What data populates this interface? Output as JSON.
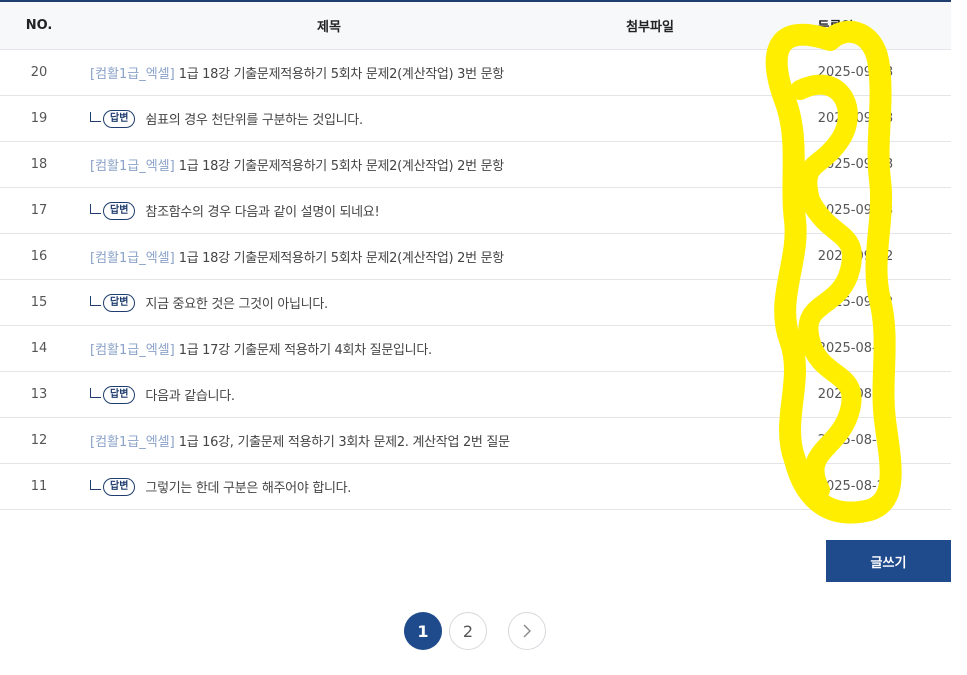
{
  "table": {
    "headers": {
      "no": "NO.",
      "title": "제목",
      "file": "첨부파일",
      "date": "등록일"
    },
    "rows": [
      {
        "no": "20",
        "type": "post",
        "category": "[컴활1급_엑셀]",
        "subject": "1급 18강 기출문제적용하기 5회차 문제2(계산작업) 3번 문항",
        "date": "2025-09-03"
      },
      {
        "no": "19",
        "type": "reply",
        "badge": "답변",
        "subject": "쉼표의 경우 천단위를 구분하는 것입니다.",
        "date": "2025-09-03"
      },
      {
        "no": "18",
        "type": "post",
        "category": "[컴활1급_엑셀]",
        "subject": "1급 18강 기출문제적용하기 5회차 문제2(계산작업) 2번 문항",
        "date": "2025-09-03"
      },
      {
        "no": "17",
        "type": "reply",
        "badge": "답변",
        "subject": "참조함수의 경우 다음과 같이 설명이 되네요!",
        "date": "2025-09-03"
      },
      {
        "no": "16",
        "type": "post",
        "category": "[컴활1급_엑셀]",
        "subject": "1급 18강 기출문제적용하기 5회차 문제2(계산작업) 2번 문항",
        "date": "2025-09-02"
      },
      {
        "no": "15",
        "type": "reply",
        "badge": "답변",
        "subject": "지금 중요한 것은 그것이 아닙니다.",
        "date": "2025-09-02"
      },
      {
        "no": "14",
        "type": "post",
        "category": "[컴활1급_엑셀]",
        "subject": "1급 17강 기출문제 적용하기 4회차 질문입니다.",
        "date": "2025-08-30"
      },
      {
        "no": "13",
        "type": "reply",
        "badge": "답변",
        "subject": "다음과 같습니다.",
        "date": "2025-08-30"
      },
      {
        "no": "12",
        "type": "post",
        "category": "[컴활1급_엑셀]",
        "subject": "1급 16강, 기출문제 적용하기 3회차 문제2. 계산작업 2번 질문",
        "date": "2025-08-29"
      },
      {
        "no": "11",
        "type": "reply",
        "badge": "답변",
        "subject": "그렇기는 한데 구분은 해주어야 합니다.",
        "date": "2025-08-29"
      }
    ]
  },
  "write_button": {
    "label": "글쓰기"
  },
  "pagination": {
    "pages": [
      "1",
      "2"
    ],
    "current": "1",
    "next_icon": "chevron-right-icon"
  },
  "colors": {
    "accent": "#1f4a8c",
    "category": "#8aa2c8",
    "scribble": "#ffee00"
  }
}
